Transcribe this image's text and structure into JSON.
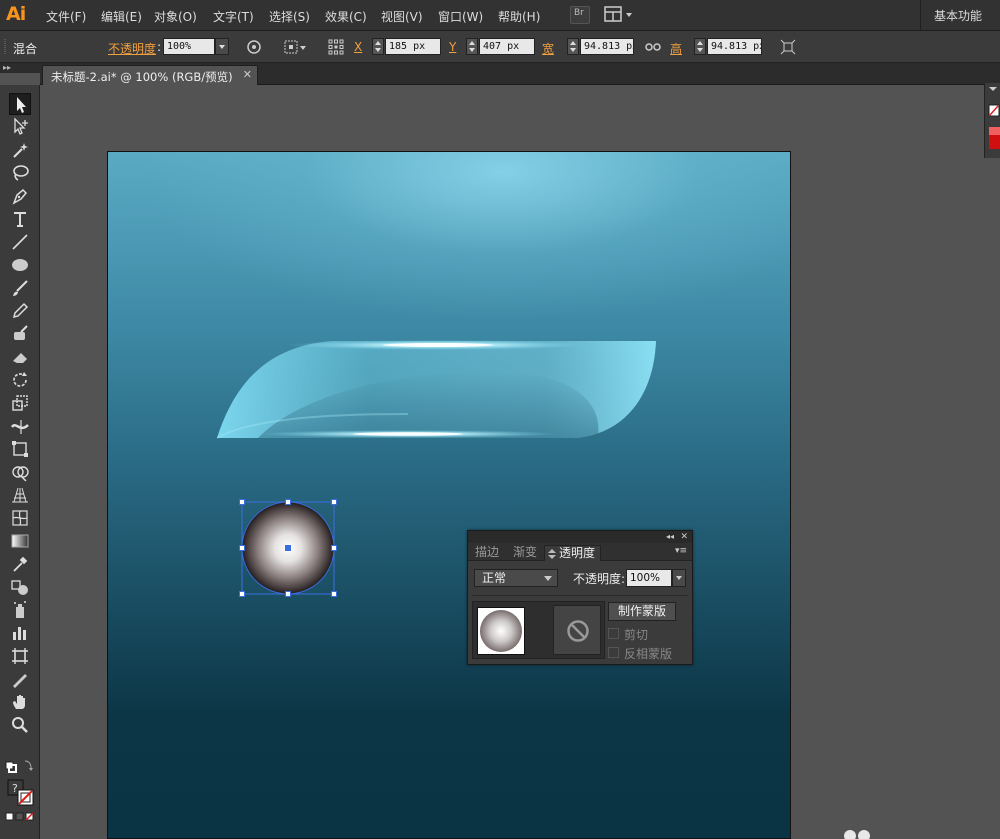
{
  "app": {
    "logo": "Ai",
    "menu": [
      "文件(F)",
      "编辑(E)",
      "对象(O)",
      "文字(T)",
      "选择(S)",
      "效果(C)",
      "视图(V)",
      "窗口(W)",
      "帮助(H)"
    ],
    "bridge_label": "Br",
    "workspace": "基本功能"
  },
  "controlbar": {
    "selection_type": "混合",
    "opacity_label": "不透明度",
    "opacity_value": "100%",
    "x_label": "X",
    "x_value": "185 px",
    "y_label": "Y",
    "y_value": "407 px",
    "w_label": "宽",
    "w_value": "94.813 px",
    "h_label": "高",
    "h_value": "94.813 px"
  },
  "document": {
    "tab_title": "未标题-2.ai* @ 100% (RGB/预览)",
    "close_symbol": "✕"
  },
  "tools": [
    "selection-tool",
    "direct-selection-tool",
    "magic-wand-tool",
    "lasso-tool",
    "pen-tool",
    "type-tool",
    "line-tool",
    "ellipse-tool",
    "paintbrush-tool",
    "pencil-tool",
    "blob-brush-tool",
    "eraser-tool",
    "rotate-tool",
    "scale-tool",
    "width-tool",
    "free-transform-tool",
    "shape-builder-tool",
    "perspective-grid-tool",
    "mesh-tool",
    "gradient-tool",
    "eyedropper-tool",
    "blend-tool",
    "symbol-sprayer-tool",
    "column-graph-tool",
    "artboard-tool",
    "slice-tool",
    "hand-tool",
    "zoom-tool"
  ],
  "transparency_panel": {
    "tabs": [
      "描边",
      "渐变",
      "透明度"
    ],
    "active_tab": "透明度",
    "blend_mode": "正常",
    "opacity_label": "不透明度:",
    "opacity_value": "100%",
    "make_mask_label": "制作蒙版",
    "clip_label": "剪切",
    "invert_mask_label": "反相蒙版"
  },
  "colors": {
    "accent_orange": "#f7941d",
    "selection_blue": "#3a6fe0"
  }
}
